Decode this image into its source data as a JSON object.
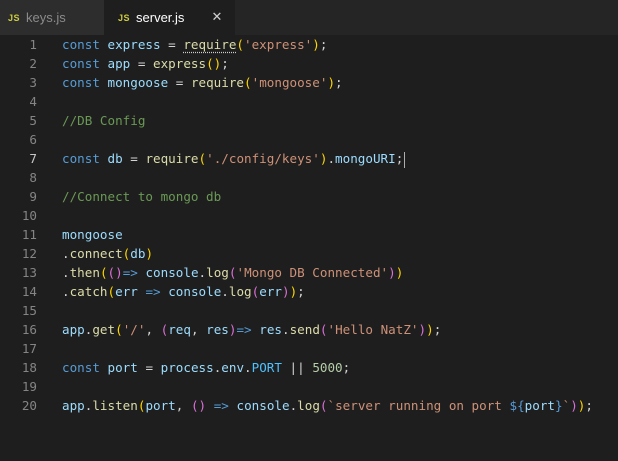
{
  "tabs": [
    {
      "icon": "JS",
      "label": "keys.js",
      "active": false
    },
    {
      "icon": "JS",
      "label": "server.js",
      "active": true,
      "close": "✕"
    }
  ],
  "colors": {
    "keyword": "#569cd6",
    "variable": "#9cdcfe",
    "function": "#dcdcaa",
    "string": "#ce9178",
    "comment": "#6a9955",
    "number": "#b5cea8",
    "punctuation": "#d4d4d4",
    "bracket1": "#ffd700",
    "bracket2": "#da70d6",
    "bracket3": "#179fff",
    "constant": "#4fc1ff"
  },
  "editor": {
    "current_line": 7,
    "lines": [
      {
        "n": "1",
        "tokens": [
          [
            "const",
            "keyword"
          ],
          [
            " ",
            "punctuation"
          ],
          [
            "express",
            "variable"
          ],
          [
            " = ",
            "punctuation"
          ],
          [
            "require",
            "function",
            "squiggle"
          ],
          [
            "(",
            "bracket1"
          ],
          [
            "'express'",
            "string"
          ],
          [
            ")",
            "bracket1"
          ],
          [
            ";",
            "punctuation"
          ]
        ]
      },
      {
        "n": "2",
        "tokens": [
          [
            "const",
            "keyword"
          ],
          [
            " ",
            "punctuation"
          ],
          [
            "app",
            "variable"
          ],
          [
            " = ",
            "punctuation"
          ],
          [
            "express",
            "function"
          ],
          [
            "()",
            "bracket1"
          ],
          [
            ";",
            "punctuation"
          ]
        ]
      },
      {
        "n": "3",
        "tokens": [
          [
            "const",
            "keyword"
          ],
          [
            " ",
            "punctuation"
          ],
          [
            "mongoose",
            "variable"
          ],
          [
            " = ",
            "punctuation"
          ],
          [
            "require",
            "function"
          ],
          [
            "(",
            "bracket1"
          ],
          [
            "'mongoose'",
            "string"
          ],
          [
            ")",
            "bracket1"
          ],
          [
            ";",
            "punctuation"
          ]
        ]
      },
      {
        "n": "4",
        "tokens": []
      },
      {
        "n": "5",
        "tokens": [
          [
            "//DB Config",
            "comment"
          ]
        ]
      },
      {
        "n": "6",
        "tokens": []
      },
      {
        "n": "7",
        "tokens": [
          [
            "const",
            "keyword"
          ],
          [
            " ",
            "punctuation"
          ],
          [
            "db",
            "variable"
          ],
          [
            " = ",
            "punctuation"
          ],
          [
            "require",
            "function"
          ],
          [
            "(",
            "bracket1"
          ],
          [
            "'./config/keys'",
            "string"
          ],
          [
            ")",
            "bracket1"
          ],
          [
            ".",
            "punctuation"
          ],
          [
            "mongoURI",
            "variable"
          ],
          [
            ";",
            "punctuation"
          ]
        ]
      },
      {
        "n": "8",
        "tokens": []
      },
      {
        "n": "9",
        "tokens": [
          [
            "//Connect to mongo db",
            "comment"
          ]
        ]
      },
      {
        "n": "10",
        "tokens": []
      },
      {
        "n": "11",
        "tokens": [
          [
            "mongoose",
            "variable"
          ]
        ]
      },
      {
        "n": "12",
        "tokens": [
          [
            ".",
            "punctuation"
          ],
          [
            "connect",
            "function"
          ],
          [
            "(",
            "bracket1"
          ],
          [
            "db",
            "variable"
          ],
          [
            ")",
            "bracket1"
          ]
        ]
      },
      {
        "n": "13",
        "tokens": [
          [
            ".",
            "punctuation"
          ],
          [
            "then",
            "function"
          ],
          [
            "(",
            "bracket1"
          ],
          [
            "()",
            "bracket2"
          ],
          [
            "=>",
            "keyword"
          ],
          [
            " ",
            "punctuation"
          ],
          [
            "console",
            "variable"
          ],
          [
            ".",
            "punctuation"
          ],
          [
            "log",
            "function"
          ],
          [
            "(",
            "bracket2"
          ],
          [
            "'Mongo DB Connected'",
            "string"
          ],
          [
            ")",
            "bracket2"
          ],
          [
            ")",
            "bracket1"
          ]
        ]
      },
      {
        "n": "14",
        "tokens": [
          [
            ".",
            "punctuation"
          ],
          [
            "catch",
            "function"
          ],
          [
            "(",
            "bracket1"
          ],
          [
            "err",
            "variable"
          ],
          [
            " ",
            "punctuation"
          ],
          [
            "=>",
            "keyword"
          ],
          [
            " ",
            "punctuation"
          ],
          [
            "console",
            "variable"
          ],
          [
            ".",
            "punctuation"
          ],
          [
            "log",
            "function"
          ],
          [
            "(",
            "bracket2"
          ],
          [
            "err",
            "variable"
          ],
          [
            ")",
            "bracket2"
          ],
          [
            ")",
            "bracket1"
          ],
          [
            ";",
            "punctuation"
          ]
        ]
      },
      {
        "n": "15",
        "tokens": []
      },
      {
        "n": "16",
        "tokens": [
          [
            "app",
            "variable"
          ],
          [
            ".",
            "punctuation"
          ],
          [
            "get",
            "function"
          ],
          [
            "(",
            "bracket1"
          ],
          [
            "'/'",
            "string"
          ],
          [
            ", ",
            "punctuation"
          ],
          [
            "(",
            "bracket2"
          ],
          [
            "req",
            "variable"
          ],
          [
            ", ",
            "punctuation"
          ],
          [
            "res",
            "variable"
          ],
          [
            ")",
            "bracket2"
          ],
          [
            "=>",
            "keyword"
          ],
          [
            " ",
            "punctuation"
          ],
          [
            "res",
            "variable"
          ],
          [
            ".",
            "punctuation"
          ],
          [
            "send",
            "function"
          ],
          [
            "(",
            "bracket2"
          ],
          [
            "'Hello NatZ'",
            "string"
          ],
          [
            ")",
            "bracket2"
          ],
          [
            ")",
            "bracket1"
          ],
          [
            ";",
            "punctuation"
          ]
        ]
      },
      {
        "n": "17",
        "tokens": []
      },
      {
        "n": "18",
        "tokens": [
          [
            "const",
            "keyword"
          ],
          [
            " ",
            "punctuation"
          ],
          [
            "port",
            "variable"
          ],
          [
            " = ",
            "punctuation"
          ],
          [
            "process",
            "variable"
          ],
          [
            ".",
            "punctuation"
          ],
          [
            "env",
            "variable"
          ],
          [
            ".",
            "punctuation"
          ],
          [
            "PORT",
            "constant"
          ],
          [
            " || ",
            "punctuation"
          ],
          [
            "5000",
            "number"
          ],
          [
            ";",
            "punctuation"
          ]
        ]
      },
      {
        "n": "19",
        "tokens": []
      },
      {
        "n": "20",
        "tokens": [
          [
            "app",
            "variable"
          ],
          [
            ".",
            "punctuation"
          ],
          [
            "listen",
            "function"
          ],
          [
            "(",
            "bracket1"
          ],
          [
            "port",
            "variable"
          ],
          [
            ", ",
            "punctuation"
          ],
          [
            "()",
            "bracket2"
          ],
          [
            " ",
            "punctuation"
          ],
          [
            "=>",
            "keyword"
          ],
          [
            " ",
            "punctuation"
          ],
          [
            "console",
            "variable"
          ],
          [
            ".",
            "punctuation"
          ],
          [
            "log",
            "function"
          ],
          [
            "(",
            "bracket2"
          ],
          [
            "`server running on port ",
            "string"
          ],
          [
            "${",
            "keyword"
          ],
          [
            "port",
            "variable"
          ],
          [
            "}",
            "keyword"
          ],
          [
            "`",
            "string"
          ],
          [
            ")",
            "bracket2"
          ],
          [
            ")",
            "bracket1"
          ],
          [
            ";",
            "punctuation"
          ]
        ]
      }
    ]
  }
}
